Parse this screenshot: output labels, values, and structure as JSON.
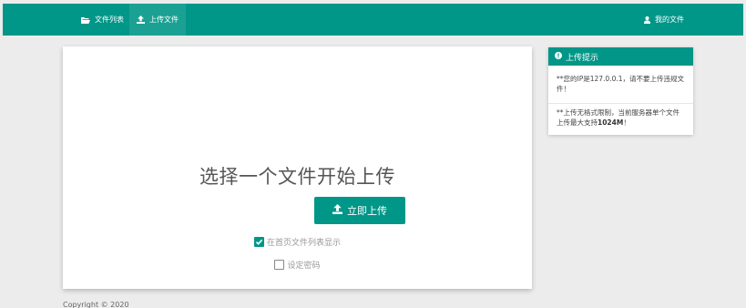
{
  "nav": {
    "file_list": "文件列表",
    "upload_file": "上传文件",
    "my_files": "我的文件"
  },
  "upload": {
    "title": "选择一个文件开始上传",
    "button_label": "立即上传",
    "show_on_home_label": "在首页文件列表显示",
    "show_on_home_checked": true,
    "set_password_label": "设定密码",
    "set_password_checked": false
  },
  "tips": {
    "header": "上传提示",
    "tip1": "**您的IP是127.0.0.1，请不要上传违规文件！",
    "tip2_prefix": "**上传无格式限制，当前服务器单个文件上传最大支持",
    "tip2_bold": "1024M",
    "tip2_suffix": "！"
  },
  "footer": {
    "copyright": "Copyright © 2020"
  },
  "colors": {
    "primary": "#009688",
    "nav_active": "#1ba193",
    "background": "#ececec"
  },
  "icons": {
    "file_list": "folder-open-icon",
    "upload_file": "upload-icon",
    "my_files": "user-icon",
    "upload_button": "upload-icon",
    "tips": "info-circle-icon"
  }
}
